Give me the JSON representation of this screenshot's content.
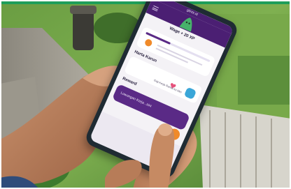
{
  "colors": {
    "accent_purple": "#5a2a86",
    "top_strip_green": "#1f9e5a",
    "phone_case": "#1f2b33",
    "mascot_green": "#47b26b",
    "badge_orange": "#f08a2a",
    "heart_pink": "#e6527c",
    "card_blue": "#3aa6d8"
  },
  "screen": {
    "status_text": "glints.id",
    "app_title": "Wage + 20 XP",
    "section_title": "Harta Karun",
    "reward_item_text": "Gaji Kerja Ramai ke Mei",
    "reward_title": "Reward",
    "promo_text": "Lowongan Kerja...sini"
  },
  "icons": {
    "mascot": "green-mascot-icon",
    "badge": "orange-badge-icon",
    "heart": "pink-heart-icon",
    "menu": "menu-icon",
    "fab": "star-icon"
  }
}
